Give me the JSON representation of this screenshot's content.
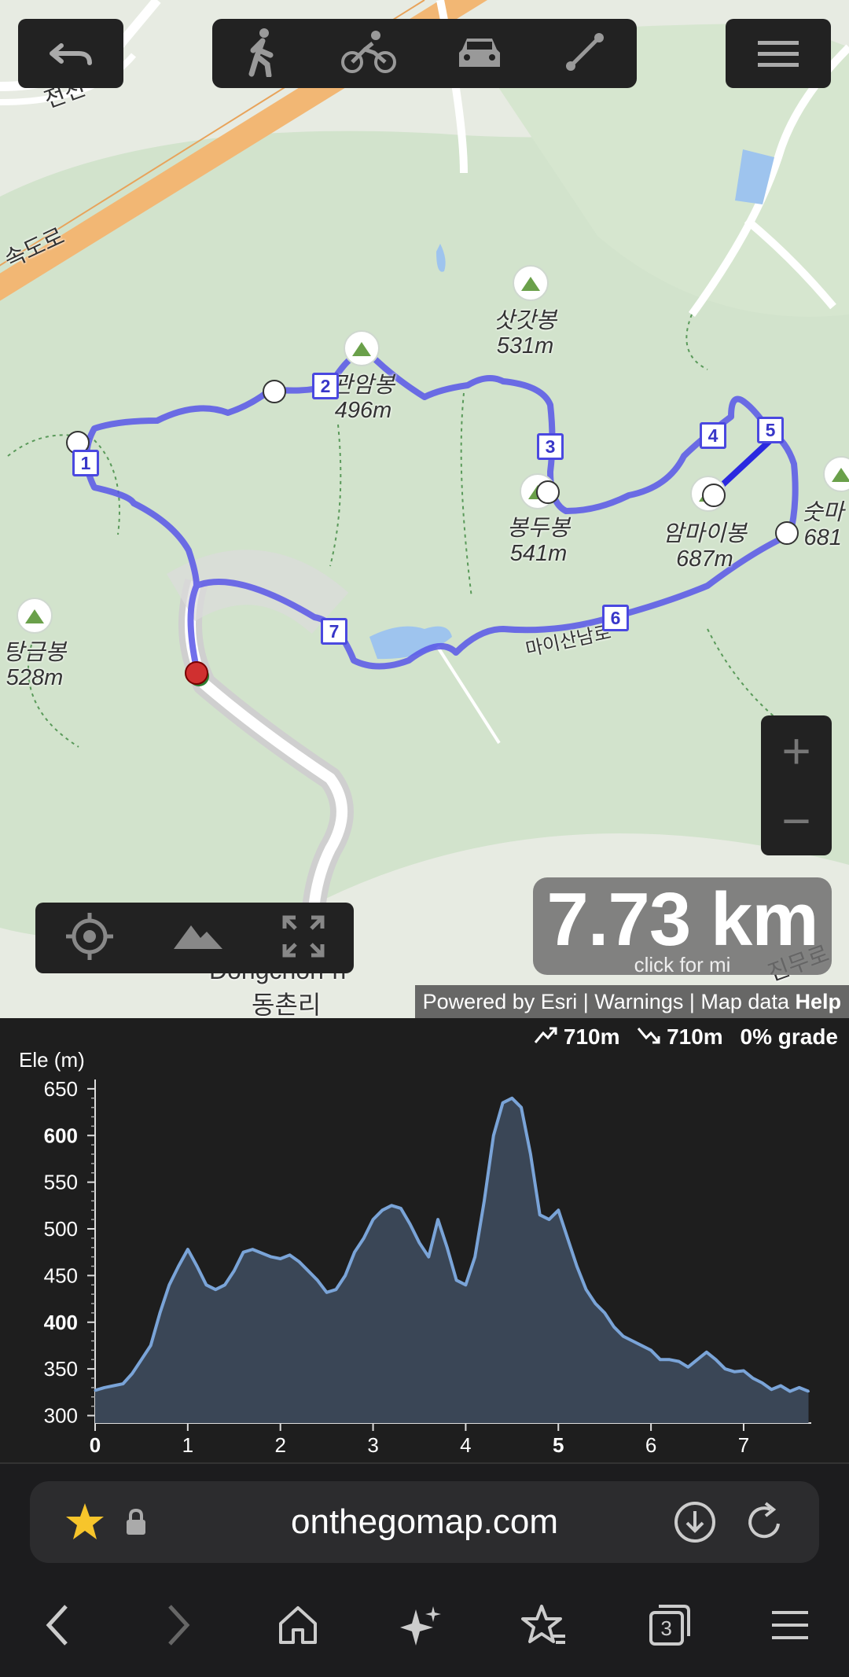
{
  "map": {
    "places": [
      {
        "name": "삿갓봉",
        "ele": "531m"
      },
      {
        "name": "관암봉",
        "ele": "496m"
      },
      {
        "name": "봉두봉",
        "ele": "541m"
      },
      {
        "name": "암마이봉",
        "ele": "687m"
      },
      {
        "name": "숫마",
        "ele": "681"
      },
      {
        "name": "탕금봉",
        "ele": "528m"
      }
    ],
    "roads": [
      "속도로",
      "전천",
      "마이산남로",
      "진무로"
    ],
    "town": [
      "Dongchon-ri",
      "동촌리"
    ],
    "waypoints": [
      "1",
      "2",
      "3",
      "4",
      "5",
      "6",
      "7"
    ]
  },
  "distance": {
    "value": "7.73 km",
    "hint": "click for mi"
  },
  "zoom": {
    "in": "+",
    "out": "−"
  },
  "attribution": {
    "esri": "Powered by Esri",
    "sep": "|",
    "warnings": "Warnings",
    "mapdata": "Map data",
    "help": "Help"
  },
  "elevation": {
    "ascent": "710m",
    "descent": "710m",
    "grade": "0% grade",
    "ylabel": "Ele (m)",
    "yticks": [
      "650",
      "600",
      "550",
      "500",
      "450",
      "400",
      "350",
      "300"
    ],
    "xticks": [
      "0",
      "1",
      "2",
      "3",
      "4",
      "5",
      "6",
      "7"
    ],
    "chart_data": {
      "type": "area",
      "xlabel": "",
      "ylabel": "Ele (m)",
      "xlim": [
        0,
        7.73
      ],
      "ylim": [
        292,
        660
      ],
      "x": [
        0,
        0.1,
        0.2,
        0.3,
        0.4,
        0.5,
        0.6,
        0.7,
        0.8,
        0.9,
        1.0,
        1.1,
        1.2,
        1.3,
        1.4,
        1.5,
        1.6,
        1.7,
        1.8,
        1.9,
        2.0,
        2.1,
        2.2,
        2.3,
        2.4,
        2.5,
        2.6,
        2.7,
        2.8,
        2.9,
        3.0,
        3.1,
        3.2,
        3.3,
        3.4,
        3.5,
        3.6,
        3.7,
        3.8,
        3.9,
        4.0,
        4.1,
        4.2,
        4.3,
        4.4,
        4.5,
        4.6,
        4.7,
        4.8,
        4.9,
        5.0,
        5.1,
        5.2,
        5.3,
        5.4,
        5.5,
        5.6,
        5.7,
        5.8,
        5.9,
        6.0,
        6.1,
        6.2,
        6.3,
        6.4,
        6.5,
        6.6,
        6.7,
        6.8,
        6.9,
        7.0,
        7.1,
        7.2,
        7.3,
        7.4,
        7.5,
        7.6,
        7.7
      ],
      "values": [
        327,
        330,
        332,
        334,
        345,
        360,
        375,
        410,
        440,
        460,
        478,
        460,
        440,
        435,
        440,
        455,
        475,
        478,
        474,
        470,
        468,
        472,
        465,
        455,
        445,
        432,
        435,
        450,
        475,
        490,
        510,
        520,
        525,
        522,
        505,
        485,
        470,
        510,
        480,
        445,
        440,
        470,
        530,
        600,
        635,
        640,
        630,
        580,
        515,
        510,
        520,
        490,
        460,
        435,
        420,
        410,
        395,
        385,
        380,
        375,
        370,
        360,
        360,
        358,
        352,
        360,
        368,
        360,
        350,
        347,
        348,
        340,
        335,
        328,
        332,
        326,
        330,
        326
      ]
    }
  },
  "browser": {
    "url": "onthegomap.com",
    "tab_count": "3"
  },
  "colors": {
    "route": "#5a58e8",
    "accent": "#4a48e0",
    "elev_line": "#7aa4d8",
    "elev_fill": "#3a4656"
  }
}
